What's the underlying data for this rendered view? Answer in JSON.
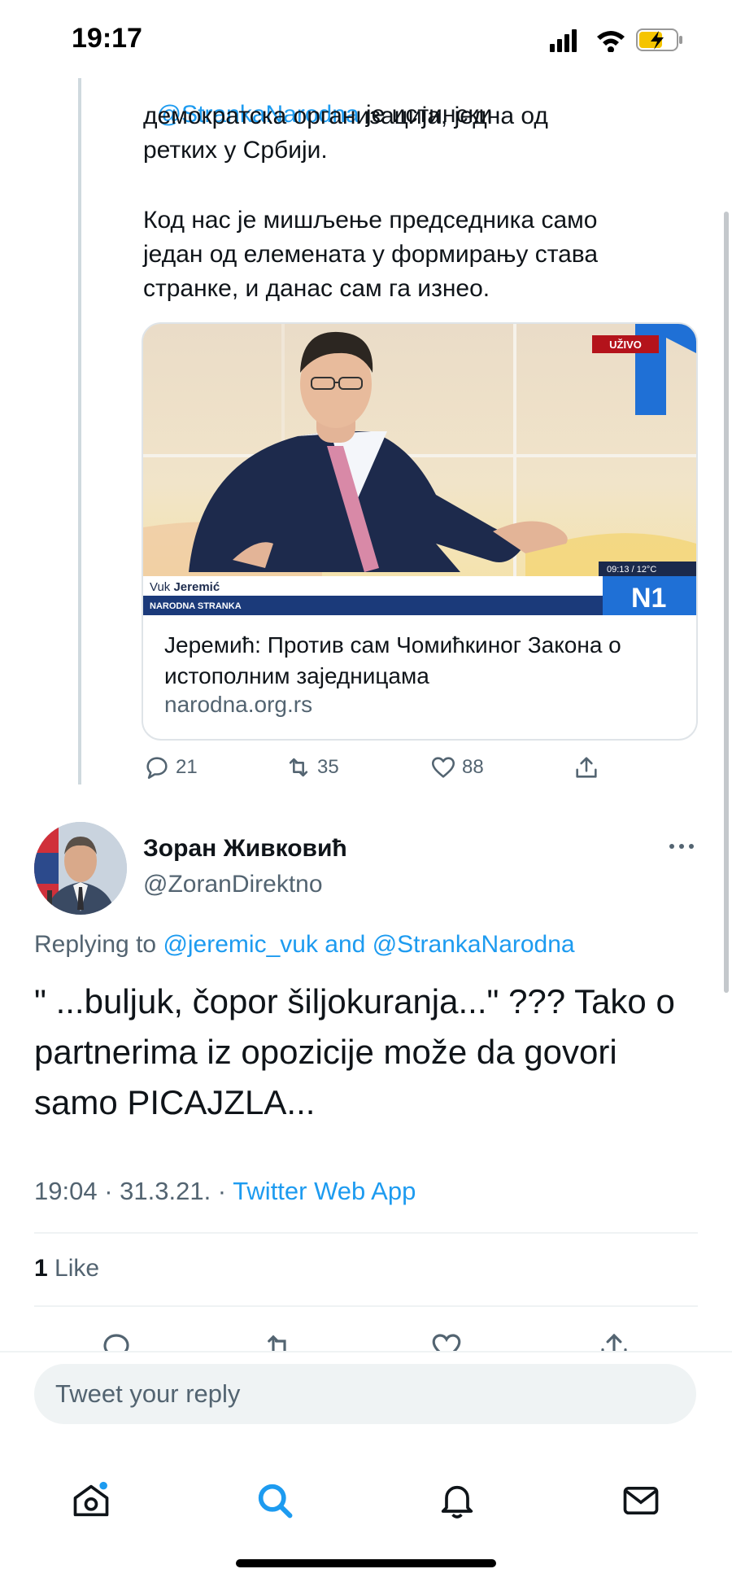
{
  "status_bar": {
    "time": "19:17"
  },
  "quoted_tweet": {
    "partial_first_line_mention": "@StrankaNarodna",
    "partial_first_line_rest": " је истински",
    "text_lines_1": "демократска организација, једна од\nретких у Србији.",
    "text_lines_2": "Код нас је мишљење председника само\nједан од елемената у формирању става\nстранке, и данас сам га изнео.",
    "card": {
      "live_badge": "UŽIVO",
      "lower_third_first": "Vuk ",
      "lower_third_last": "Jeremić",
      "lower_third_party": "NARODNA STRANKA",
      "clock": "09:13 / 12°C",
      "channel": "N1",
      "title": "Јеремић: Против сам Чомићкиног Закона о истополним заједницама",
      "domain": "narodna.org.rs"
    },
    "actions": {
      "replies": "21",
      "retweets": "35",
      "likes": "88"
    }
  },
  "reply_tweet": {
    "author_name": "Зоран Живковић",
    "author_handle": "@ZoranDirektno",
    "replying_prefix": "Replying to ",
    "replying_user1": "@jeremic_vuk",
    "replying_and": " and ",
    "replying_user2": "@StrankaNarodna",
    "text": "\" ...buljuk, čopor šiljokuranja...\" ??? Tako o partnerima iz opozicije može da govori samo PICAJZLA...",
    "time": "19:04",
    "date": "31.3.21.",
    "source": "Twitter Web App",
    "like_count": "1",
    "like_label": "Like"
  },
  "reply_box": {
    "placeholder": "Tweet your reply"
  },
  "tab_bar": {
    "icons": [
      "home-icon",
      "search-icon",
      "notifications-icon",
      "messages-icon"
    ],
    "accent": "#1d9bf0"
  },
  "colors": {
    "accent": "#1d9bf0",
    "secondary_text": "#536471",
    "primary_text": "#0f1419"
  }
}
